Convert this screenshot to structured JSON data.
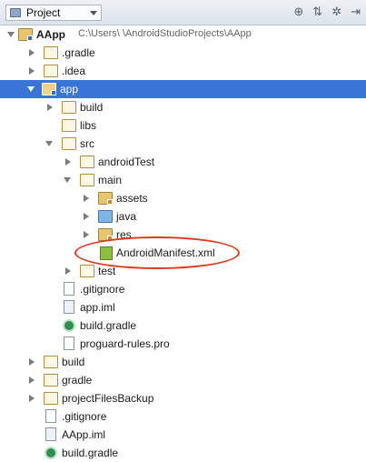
{
  "toolbar": {
    "panel_label": "Project",
    "icons": [
      "target-icon",
      "collapse-icon",
      "gear-icon",
      "hide-icon"
    ]
  },
  "root": {
    "name": "AApp",
    "path": "C:\\Users\\          \\AndroidStudioProjects\\AApp"
  },
  "tree": {
    "gradle_folder": ".gradle",
    "idea_folder": ".idea",
    "app_folder": "app",
    "build_folder": "build",
    "libs_folder": "libs",
    "src_folder": "src",
    "android_test_folder": "androidTest",
    "main_folder": "main",
    "assets_folder": "assets",
    "java_folder": "java",
    "res_folder": "res",
    "manifest_file": "AndroidManifest.xml",
    "test_folder": "test",
    "app_gitignore": ".gitignore",
    "app_iml": "app.iml",
    "app_build_gradle": "build.gradle",
    "proguard": "proguard-rules.pro",
    "root_build": "build",
    "root_gradle": "gradle",
    "project_files_backup": "projectFilesBackup",
    "root_gitignore": ".gitignore",
    "aapp_iml": "AApp.iml",
    "root_build_gradle": "build.gradle"
  }
}
